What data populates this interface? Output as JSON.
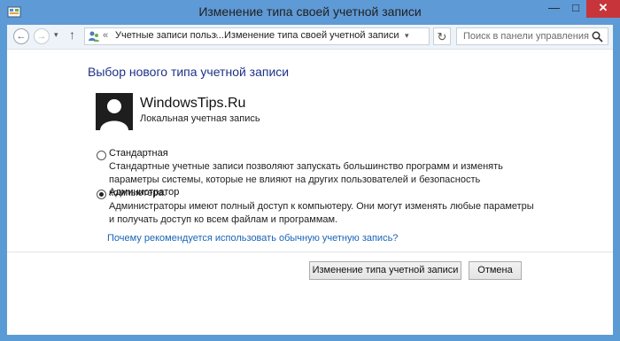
{
  "window": {
    "title": "Изменение типа своей учетной записи",
    "minimize_glyph": "—",
    "maximize_glyph": "□",
    "close_glyph": "✕"
  },
  "navbar": {
    "back_glyph": "←",
    "forward_glyph": "→",
    "history_glyph": "▾",
    "up_glyph": "↑",
    "breadcrumb_sep": "«",
    "breadcrumb_arrow": "›",
    "breadcrumbs": [
      "Учетные записи польз...",
      "Изменение типа своей учетной записи"
    ],
    "address_dropdown_glyph": "▾",
    "refresh_glyph": "↻",
    "search_placeholder": "Поиск в панели управления"
  },
  "main": {
    "heading": "Выбор нового типа учетной записи",
    "account": {
      "name": "WindowsTips.Ru",
      "type": "Локальная учетная запись"
    },
    "options": [
      {
        "label": "Стандартная",
        "description": "Стандартные учетные записи позволяют запускать большинство программ и изменять параметры системы, которые не влияют на других пользователей и безопасность компьютера.",
        "selected": false
      },
      {
        "label": "Администратор",
        "description": "Администраторы имеют полный доступ к компьютеру. Они могут изменять любые параметры и получать доступ ко всем файлам и программам.",
        "selected": true
      }
    ],
    "help_link": "Почему рекомендуется использовать обычную учетную запись?"
  },
  "footer": {
    "change_button": "Изменение типа учетной записи",
    "cancel_button": "Отмена"
  },
  "colors": {
    "frame": "#5e9ad6",
    "close_button": "#c7343a",
    "heading": "#1e3287",
    "link": "#1a64b6"
  },
  "icons": [
    "control-panel-app-icon",
    "users-folder-icon",
    "search-icon",
    "avatar-icon",
    "refresh-icon"
  ]
}
